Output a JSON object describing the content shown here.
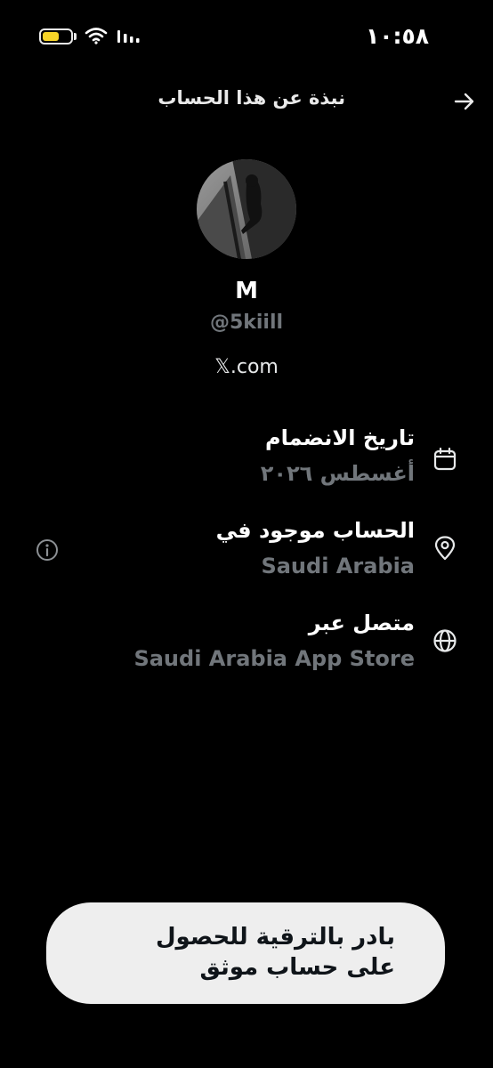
{
  "status_bar": {
    "time": "١٠:٥٨",
    "battery_color": "#f6d428",
    "icons": [
      "battery-icon",
      "wifi-icon",
      "signal-icon"
    ]
  },
  "header": {
    "title": "نبذة عن هذا الحساب",
    "back_icon": "arrow-right-icon"
  },
  "profile": {
    "display_name": "M",
    "username": "@5kiill",
    "website": "𝕏.com"
  },
  "info_rows": [
    {
      "icon": "calendar-icon",
      "title": "تاريخ الانضمام",
      "value": "أغسطس ٢٠٢٦"
    },
    {
      "icon": "location-pin-icon",
      "title": "الحساب موجود في",
      "value": "Saudi Arabia",
      "extra_icon": "info-circle-icon"
    },
    {
      "icon": "globe-icon",
      "title": "متصل عبر",
      "value": "Saudi Arabia App Store"
    }
  ],
  "upgrade_banner": {
    "text": "بادر بالترقية للحصول على حساب موثق"
  },
  "colors": {
    "background": "#000000",
    "primary_text": "#ffffff",
    "secondary_text": "#71767b",
    "banner_bg": "#eeeeee",
    "banner_text": "#0f1419"
  }
}
